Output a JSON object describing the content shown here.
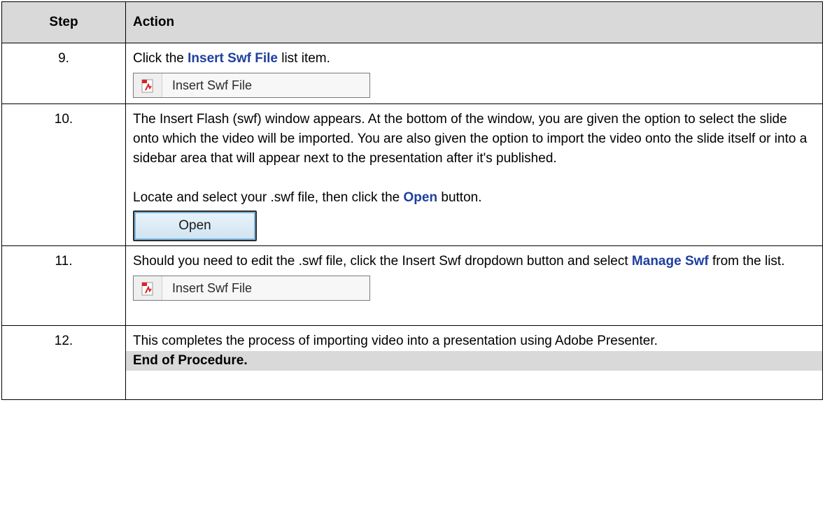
{
  "header": {
    "step": "Step",
    "action": "Action"
  },
  "rows": [
    {
      "num": "9.",
      "pre": "Click the ",
      "kw": "Insert Swf File",
      "post": " list item.",
      "shot_label": "Insert Swf File"
    },
    {
      "num": "10.",
      "para1": "The Insert Flash (swf) window appears.  At the bottom of the window, you are given the option to select the slide onto which the video will be imported.  You are also given the option to import the video onto the slide itself or into a sidebar area that will appear next to the presentation after it's published.",
      "pre": "Locate and select your .swf file, then click the ",
      "kw": "Open",
      "post": " button.",
      "button_label": "Open"
    },
    {
      "num": "11.",
      "pre": "Should you need to edit the .swf file, click the Insert Swf dropdown button and select ",
      "kw": "Manage Swf",
      "post": " from the list.",
      "shot_label": "Insert Swf File"
    },
    {
      "num": "12.",
      "text": "This completes the process of importing video into a presentation using Adobe Presenter.",
      "end": "End of Procedure."
    }
  ],
  "icons": {
    "file": "swf-file-icon"
  },
  "colors": {
    "header_bg": "#d9d9d9",
    "keyword": "#1f3f9f"
  }
}
